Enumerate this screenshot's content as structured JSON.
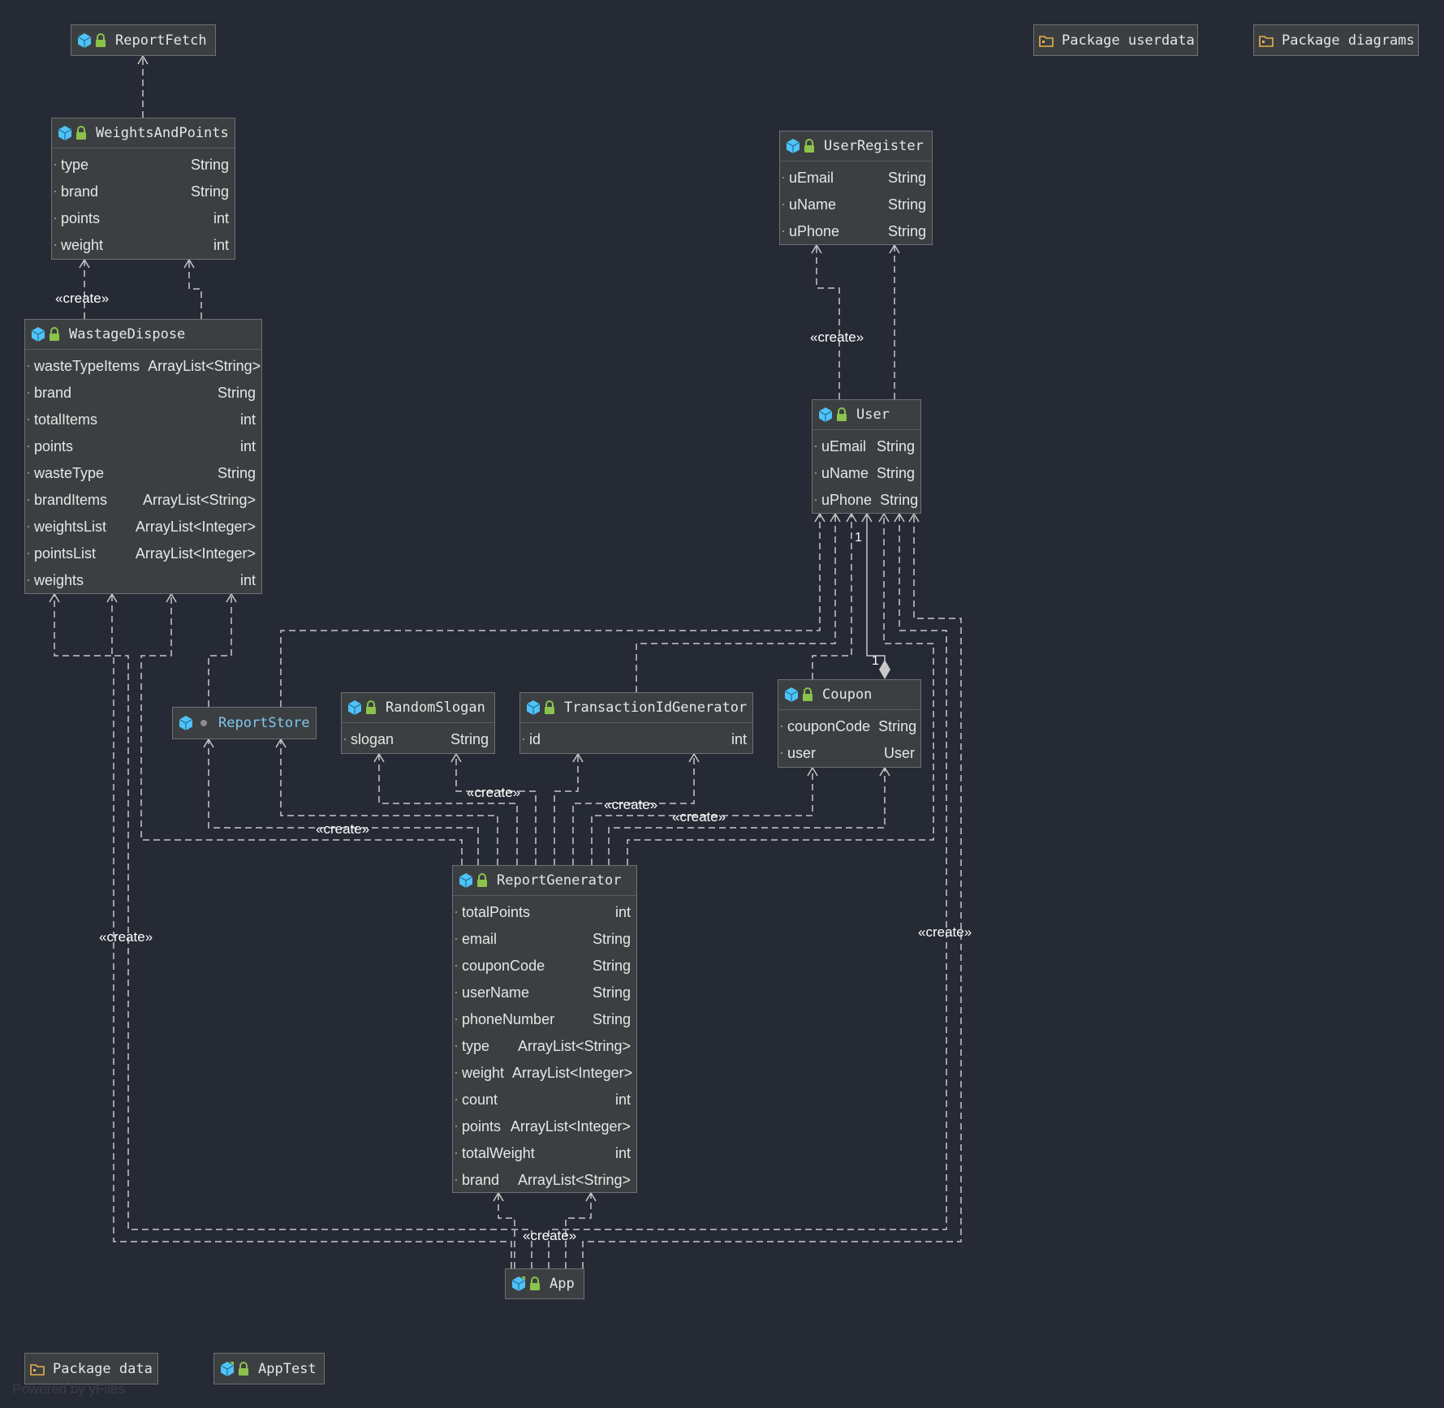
{
  "colors": {
    "background": "#262a34",
    "node": "#3c3f41",
    "edge": "#c8c8c8",
    "class_icon": "#4fc3f7",
    "lock_icon": "#8bc34a",
    "folder_icon": "#e8b04a"
  },
  "packages": {
    "userdata": "Package userdata",
    "diagrams": "Package diagrams",
    "data": "Package data"
  },
  "classes": {
    "reportfetch": {
      "name": "ReportFetch"
    },
    "weightsandpoints": {
      "name": "WeightsAndPoints",
      "fields": [
        {
          "name": "type",
          "type": "String"
        },
        {
          "name": "brand",
          "type": "String"
        },
        {
          "name": "points",
          "type": "int"
        },
        {
          "name": "weight",
          "type": "int"
        }
      ]
    },
    "wastagedispose": {
      "name": "WastageDispose",
      "fields": [
        {
          "name": "wasteTypeItems",
          "type": "ArrayList<String>"
        },
        {
          "name": "brand",
          "type": "String"
        },
        {
          "name": "totalItems",
          "type": "int"
        },
        {
          "name": "points",
          "type": "int"
        },
        {
          "name": "wasteType",
          "type": "String"
        },
        {
          "name": "brandItems",
          "type": "ArrayList<String>"
        },
        {
          "name": "weightsList",
          "type": "ArrayList<Integer>"
        },
        {
          "name": "pointsList",
          "type": "ArrayList<Integer>"
        },
        {
          "name": "weights",
          "type": "int"
        }
      ]
    },
    "userregister": {
      "name": "UserRegister",
      "fields": [
        {
          "name": "uEmail",
          "type": "String"
        },
        {
          "name": "uName",
          "type": "String"
        },
        {
          "name": "uPhone",
          "type": "String"
        }
      ]
    },
    "user": {
      "name": "User",
      "fields": [
        {
          "name": "uEmail",
          "type": "String"
        },
        {
          "name": "uName",
          "type": "String"
        },
        {
          "name": "uPhone",
          "type": "String"
        }
      ]
    },
    "reportstore": {
      "name": "ReportStore"
    },
    "randomslogan": {
      "name": "RandomSlogan",
      "fields": [
        {
          "name": "slogan",
          "type": "String"
        }
      ]
    },
    "transactionidgenerator": {
      "name": "TransactionIdGenerator",
      "fields": [
        {
          "name": "id",
          "type": "int"
        }
      ]
    },
    "coupon": {
      "name": "Coupon",
      "fields": [
        {
          "name": "couponCode",
          "type": "String"
        },
        {
          "name": "user",
          "type": "User"
        }
      ]
    },
    "reportgenerator": {
      "name": "ReportGenerator",
      "fields": [
        {
          "name": "totalPoints",
          "type": "int"
        },
        {
          "name": "email",
          "type": "String"
        },
        {
          "name": "couponCode",
          "type": "String"
        },
        {
          "name": "userName",
          "type": "String"
        },
        {
          "name": "phoneNumber",
          "type": "String"
        },
        {
          "name": "type",
          "type": "ArrayList<String>"
        },
        {
          "name": "weight",
          "type": "ArrayList<Integer>"
        },
        {
          "name": "count",
          "type": "int"
        },
        {
          "name": "points",
          "type": "ArrayList<Integer>"
        },
        {
          "name": "totalWeight",
          "type": "int"
        },
        {
          "name": "brand",
          "type": "ArrayList<String>"
        }
      ]
    },
    "app": {
      "name": "App"
    },
    "apptest": {
      "name": "AppTest"
    }
  },
  "labels": {
    "create": "«create»",
    "one": "1"
  },
  "watermark": "Powered by yFiles"
}
